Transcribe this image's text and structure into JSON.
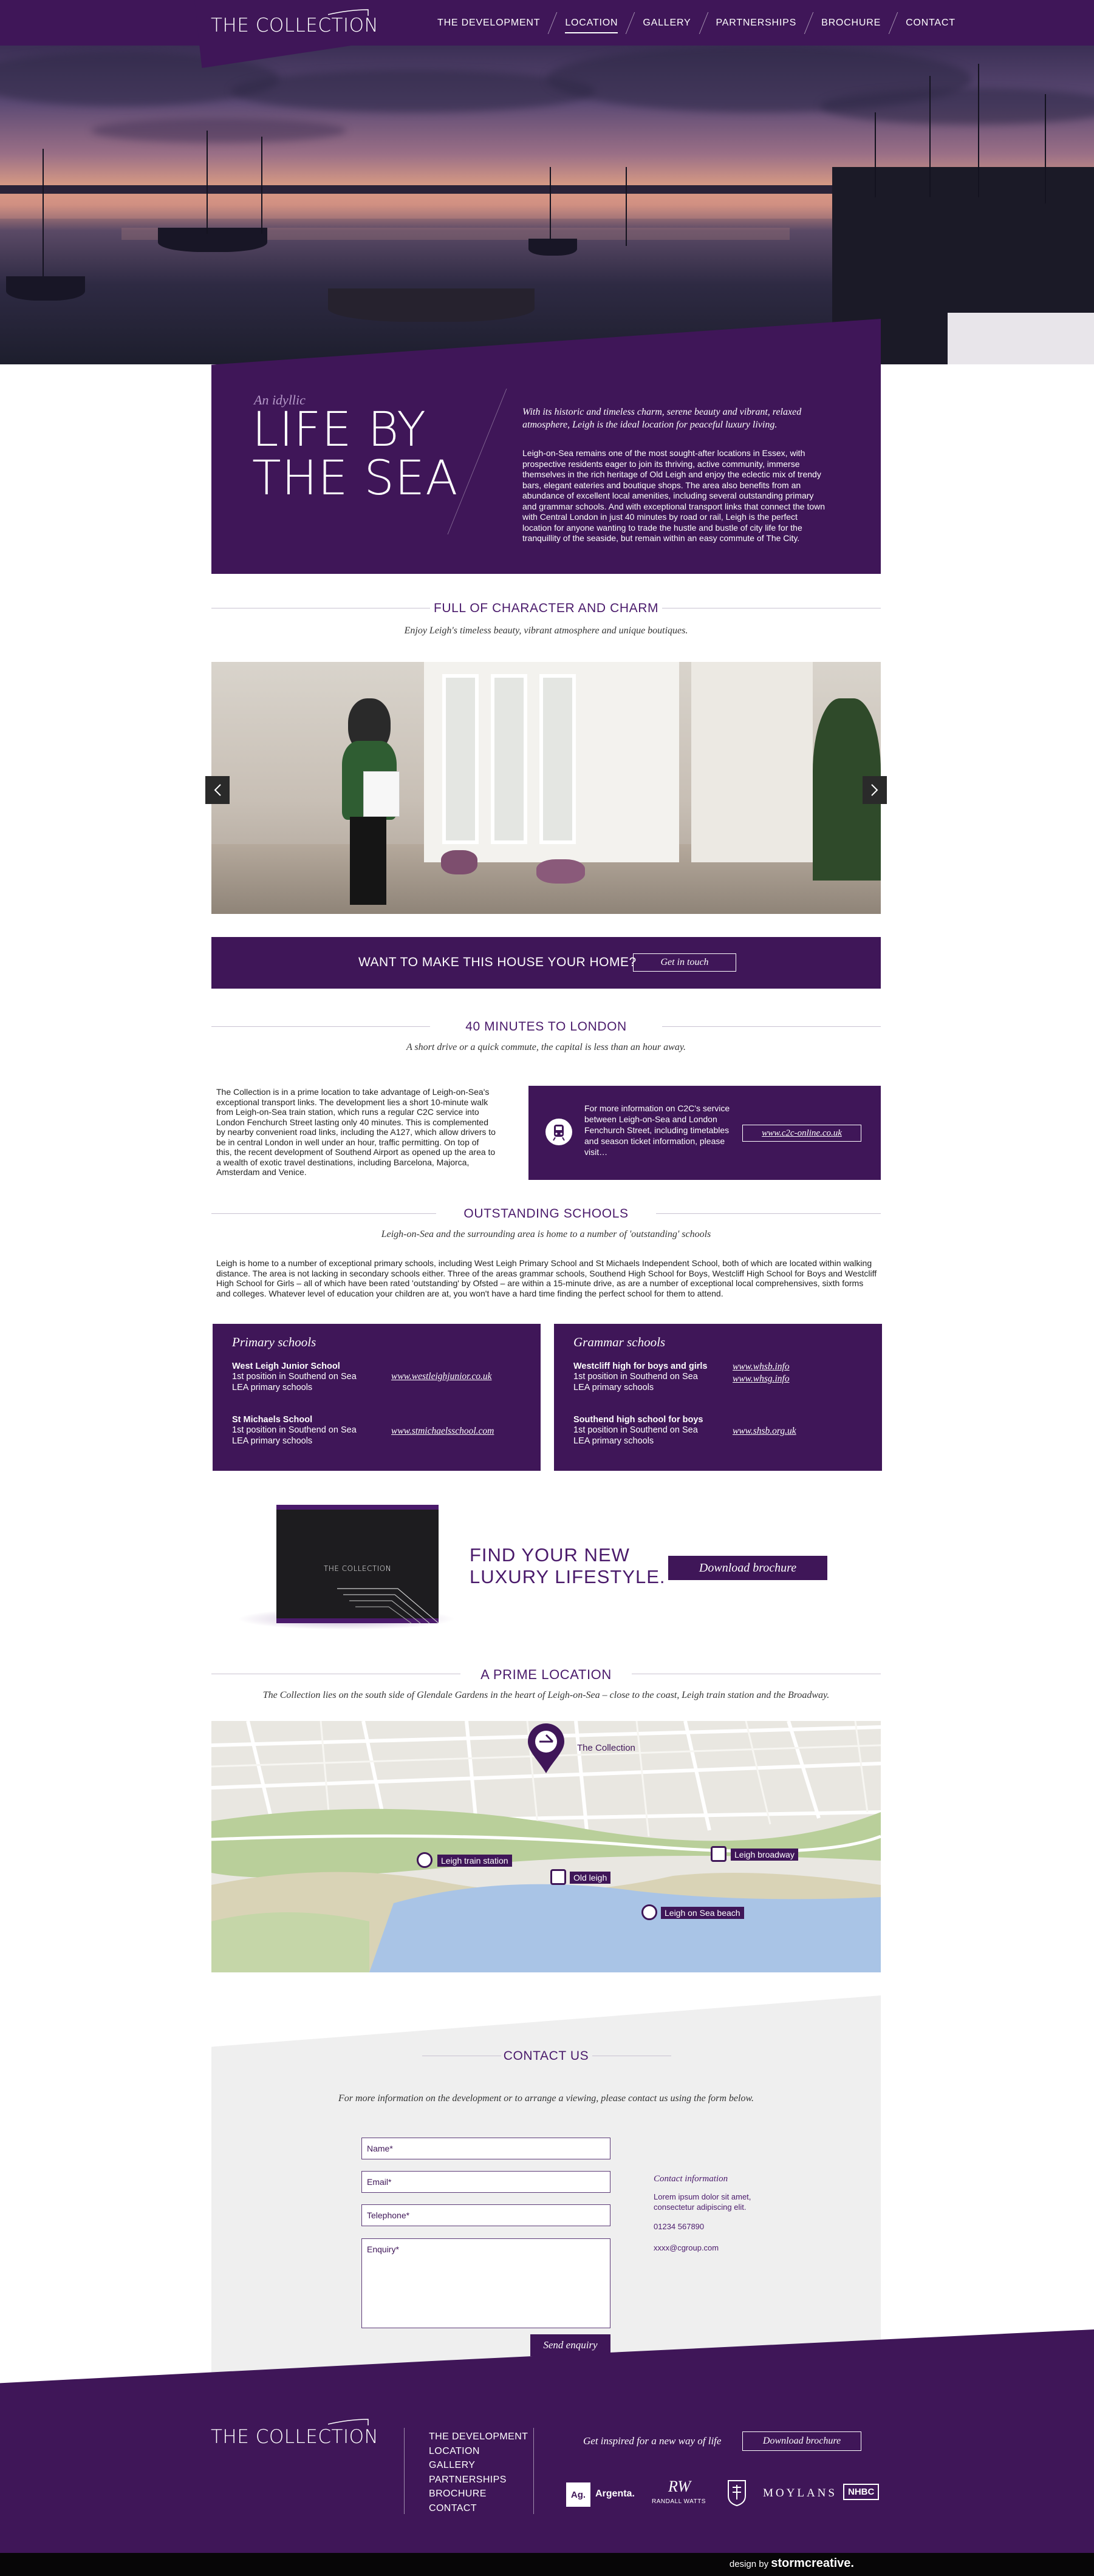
{
  "header": {
    "logo": "THE COLLECTION",
    "nav": [
      "THE DEVELOPMENT",
      "LOCATION",
      "GALLERY",
      "PARTNERSHIPS",
      "BROCHURE",
      "CONTACT"
    ],
    "active_nav": "LOCATION"
  },
  "intro": {
    "eyebrow": "An idyllic",
    "title_line1": "LIFE BY",
    "title_line2": "THE SEA",
    "lead": "With its historic and timeless charm, serene beauty and vibrant, relaxed atmosphere, Leigh is the ideal location for peaceful luxury living.",
    "body": "Leigh-on-Sea remains one of the most sought-after locations in Essex, with prospective residents eager to join its thriving, active community, immerse themselves in the rich heritage of Old Leigh and enjoy the eclectic mix of trendy bars, elegant eateries and boutique shops. The area also benefits from an abundance of excellent local amenities, including several outstanding primary and grammar schools. And with exceptional transport links that connect the town with Central London in just 40 minutes by road or rail, Leigh is the perfect location for anyone wanting to trade the hustle and bustle of city life for the tranquillity of the seaside, but remain within an easy commute of The City."
  },
  "character": {
    "heading": "FULL OF CHARACTER AND CHARM",
    "subheading": "Enjoy Leigh's timeless beauty, vibrant atmosphere and unique boutiques."
  },
  "cta": {
    "text": "WANT TO MAKE THIS HOUSE YOUR HOME?",
    "button": "Get in touch"
  },
  "london": {
    "heading": "40 MINUTES TO LONDON",
    "subheading": "A short drive or a quick commute, the capital is less than an hour away.",
    "body": "The Collection is in a prime location to take advantage of Leigh-on-Sea's exceptional transport links. The development lies a short 10-minute walk from Leigh-on-Sea train station, which runs a regular C2C service into London Fenchurch Street lasting only 40 minutes. This is complemented by nearby convenient road links, including the A127, which allow drivers to be in central London in well under an hour, traffic permitting. On top of this, the recent development of Southend Airport as opened up the area to a wealth of exotic travel destinations, including Barcelona, Majorca, Amsterdam and Venice.",
    "c2c_text": "For more information on C2C's service between Leigh-on-Sea and London Fenchurch Street, including timetables and season ticket information, please visit…",
    "c2c_link": "www.c2c-online.co.uk"
  },
  "schools": {
    "heading": "OUTSTANDING SCHOOLS",
    "subheading": "Leigh-on-Sea and the surrounding area is home to a number of 'outstanding' schools",
    "body": "Leigh is home to a number of exceptional primary schools, including West Leigh Primary School and St Michaels Independent School, both of which are located within walking distance. The area is not lacking in secondary schools either. Three of the areas grammar schools, Southend High School for Boys, Westcliff High School for Boys and Westcliff High School for Girls – all of which have been rated 'outstanding' by Ofsted – are within a 15-minute drive, as are a number of exceptional local comprehensives, sixth forms and colleges. Whatever level of education your children are at, you won't have a hard time finding the perfect school for them to attend.",
    "primary": {
      "title": "Primary schools",
      "items": [
        {
          "name": "West Leigh Junior School",
          "line1": "1st position in Southend on Sea",
          "line2": "LEA primary schools",
          "link": "www.westleighjunior.co.uk"
        },
        {
          "name": "St Michaels School",
          "line1": "1st position in Southend on Sea",
          "line2": "LEA primary schools",
          "link": "www.stmichaelsschool.com"
        }
      ]
    },
    "grammar": {
      "title": "Grammar schools",
      "items": [
        {
          "name": "Westcliff high for boys and girls",
          "line1": "1st position in Southend on Sea",
          "line2": "LEA primary schools",
          "link1": "www.whsb.info",
          "link2": "www.whsg.info"
        },
        {
          "name": "Southend high school for boys",
          "line1": "1st position in Southend on Sea",
          "line2": "LEA primary schools",
          "link1": "www.shsb.org.uk"
        }
      ]
    }
  },
  "brochure": {
    "book_logo": "THE COLLECTION",
    "title_line1": "FIND YOUR NEW",
    "title_line2": "LUXURY LIFESTYLE.",
    "button": "Download brochure"
  },
  "prime": {
    "heading": "A PRIME LOCATION",
    "subheading": "The Collection lies on the south side of Glendale Gardens in the heart of Leigh-on-Sea – close to the coast, Leigh train station and the Broadway.",
    "map_labels": {
      "collection": "The Collection",
      "station": "Leigh train station",
      "old_leigh": "Old leigh",
      "broadway": "Leigh broadway",
      "beach": "Leigh on Sea beach"
    }
  },
  "contact": {
    "heading": "CONTACT US",
    "intro": "For more information on the development or to arrange a viewing, please contact us using the form below.",
    "fields": {
      "name": "Name*",
      "email": "Email*",
      "telephone": "Telephone*",
      "enquiry": "Enquiry*"
    },
    "send": "Send enquiry",
    "info_title": "Contact information",
    "info_address": "Lorem ipsum dolor sit amet, consectetur adipiscing elit.",
    "phone": "01234 567890",
    "email": "xxxx@cgroup.com"
  },
  "footer": {
    "logo": "THE COLLECTION",
    "nav": [
      "THE DEVELOPMENT",
      "LOCATION",
      "GALLERY",
      "PARTNERSHIPS",
      "BROCHURE",
      "CONTACT"
    ],
    "inspired": "Get inspired for a new way of life",
    "button": "Download brochure",
    "partners": {
      "argenta_mark": "Ag.",
      "argenta": "Argenta.",
      "randall_mark": "RW",
      "randall": "RANDALL WATTS",
      "moylans": "MOYLANS",
      "nhbc": "NHBC"
    },
    "credit_prefix": "design by",
    "credit_brand": "stormcreative."
  },
  "colors": {
    "primary_purple": "#3f1658",
    "heading_purple": "#4a1a6b",
    "panel_grey": "#efefef"
  }
}
